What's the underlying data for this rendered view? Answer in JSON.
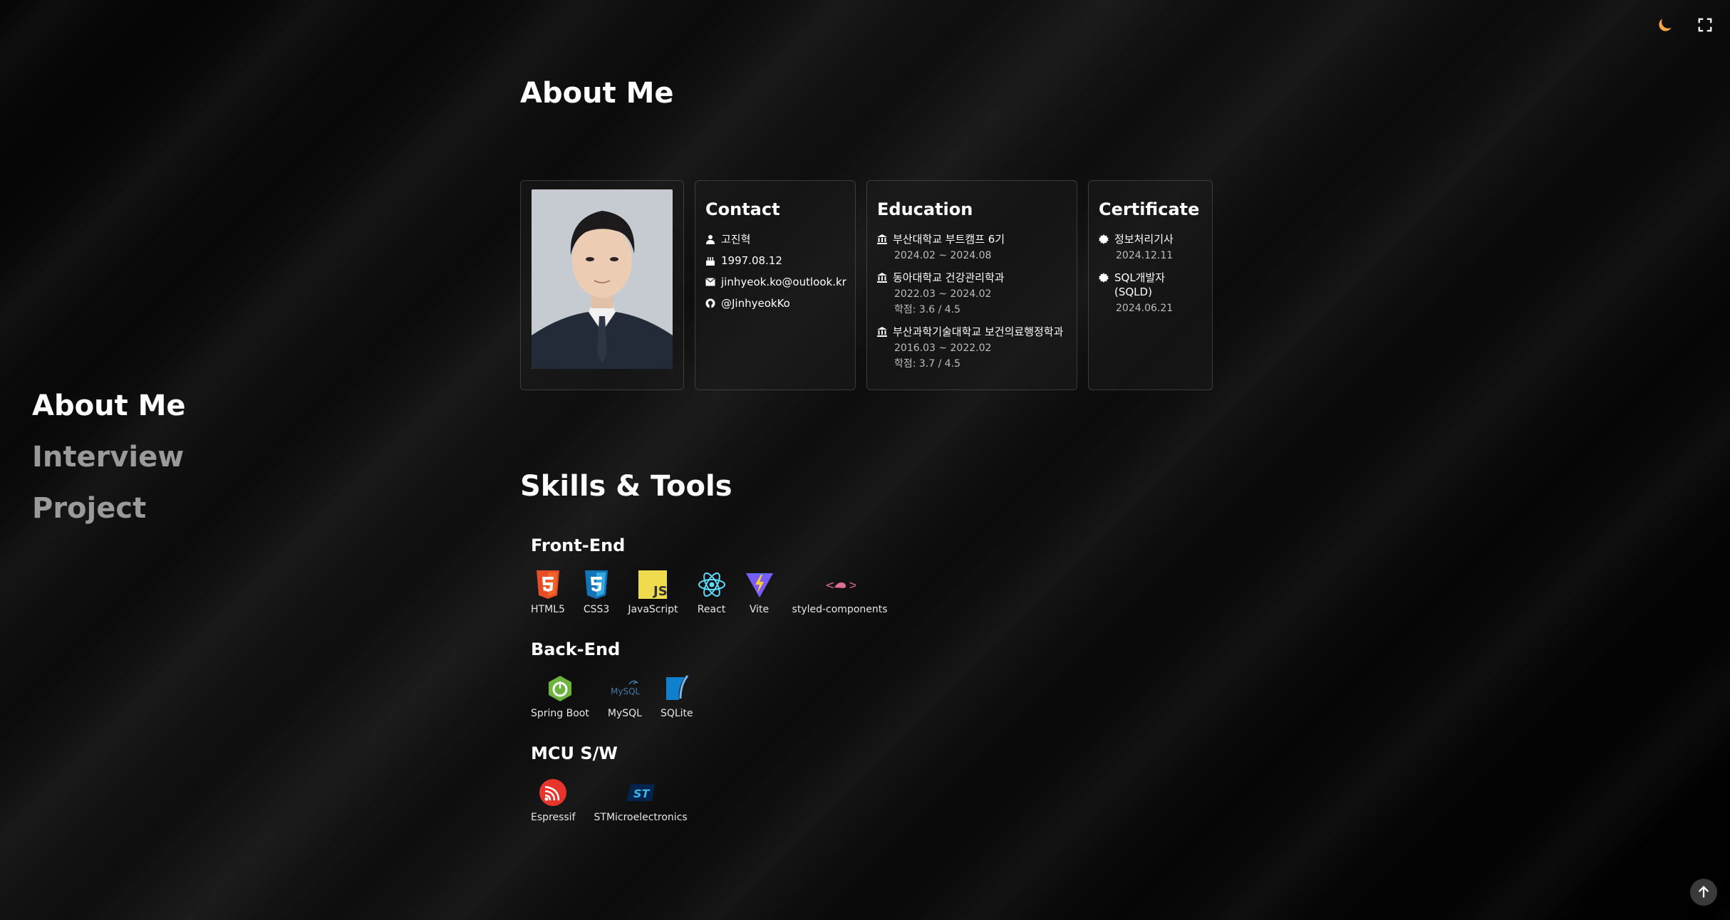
{
  "nav": {
    "items": [
      {
        "label": "About Me",
        "active": true
      },
      {
        "label": "Interview",
        "active": false
      },
      {
        "label": "Project",
        "active": false
      }
    ]
  },
  "controls": {
    "theme_icon": "moon-icon",
    "fullscreen_icon": "fullscreen-icon",
    "scroll_top_icon": "arrow-up-icon"
  },
  "about": {
    "title": "About Me",
    "contact": {
      "title": "Contact",
      "name": "고진혁",
      "birth": "1997.08.12",
      "email": "jinhyeok.ko@outlook.kr",
      "github": "@JinhyeokKo"
    },
    "education": {
      "title": "Education",
      "items": [
        {
          "school": "부산대학교 부트캠프 6기",
          "period": "2024.02 ~ 2024.08",
          "gpa": ""
        },
        {
          "school": "동아대학교 건강관리학과",
          "period": "2022.03 ~ 2024.02",
          "gpa": "학점: 3.6 / 4.5"
        },
        {
          "school": "부산과학기술대학교 보건의료행정학과",
          "period": "2016.03 ~ 2022.02",
          "gpa": "학점: 3.7 / 4.5"
        }
      ]
    },
    "certificate": {
      "title": "Certificate",
      "items": [
        {
          "name": "정보처리기사",
          "date": "2024.12.11"
        },
        {
          "name": "SQL개발자(SQLD)",
          "date": "2024.06.21"
        }
      ]
    }
  },
  "skills": {
    "title": "Skills & Tools",
    "frontend": {
      "title": "Front-End",
      "items": [
        "HTML5",
        "CSS3",
        "JavaScript",
        "React",
        "Vite",
        "styled-components"
      ]
    },
    "backend": {
      "title": "Back-End",
      "items": [
        "Spring Boot",
        "MySQL",
        "SQLite"
      ]
    },
    "mcu": {
      "title": "MCU S/W",
      "items": [
        "Espressif",
        "STMicroelectronics"
      ]
    }
  },
  "colors": {
    "accent_moon": "#f5a742",
    "html5": "#e44d26",
    "css3": "#1572b6",
    "js": "#f0db4f",
    "react": "#61dafb",
    "vite": "#646cff",
    "spring": "#6db33f",
    "espressif": "#e7352c",
    "stm": "#03234b"
  }
}
